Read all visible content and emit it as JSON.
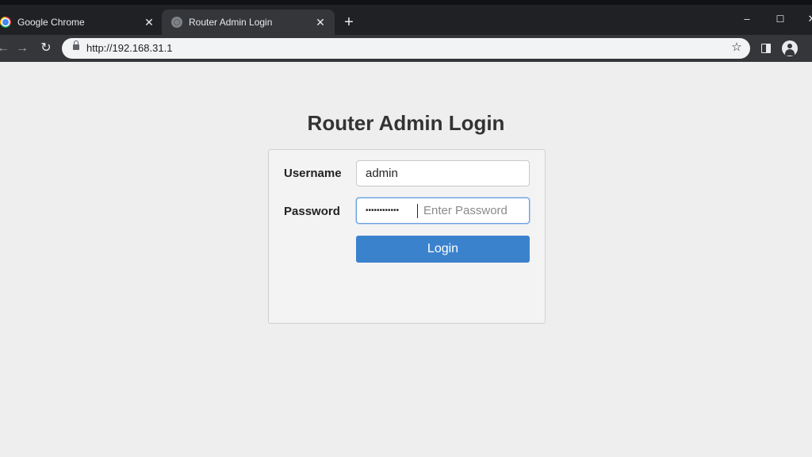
{
  "browser": {
    "tabs": [
      {
        "title": "Google Chrome",
        "icon": "chrome-icon",
        "active": false
      },
      {
        "title": "Router Admin Login",
        "icon": "globe-icon",
        "active": true
      }
    ],
    "new_tab_label": "+",
    "url": "http://192.168.31.1",
    "colors": {
      "tab_bar": "#202124",
      "active_tab": "#35363a",
      "omnibox": "#f1f3f4"
    }
  },
  "page": {
    "title": "Router Admin Login",
    "username": {
      "label": "Username",
      "value": "admin"
    },
    "password": {
      "label": "Password",
      "masked_value": "••••••••••••",
      "placeholder": "Enter Password"
    },
    "login_button": "Login",
    "colors": {
      "button": "#3b82cd",
      "background": "#eeeeee"
    }
  }
}
